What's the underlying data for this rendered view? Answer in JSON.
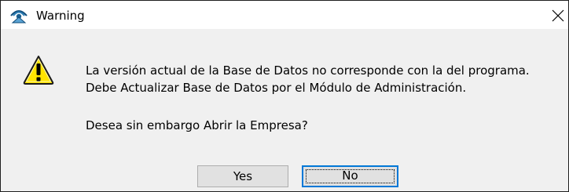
{
  "window": {
    "title": "Warning",
    "title_icon": "app-icon",
    "close_icon": "close-icon"
  },
  "dialog": {
    "icon": "warning-icon",
    "message_line1": "La versión actual de la Base de Datos no corresponde con la del programa.",
    "message_line2": "Debe Actualizar Base de Datos por el Módulo de Administración.",
    "question": "Desea sin embargo Abrir la Empresa?"
  },
  "buttons": {
    "yes_label": "Yes",
    "no_label": "No",
    "default": "No"
  },
  "colors": {
    "dialog_background": "#f0f0f0",
    "focus_border": "#0078d7",
    "warning_yellow": "#ffe400"
  }
}
